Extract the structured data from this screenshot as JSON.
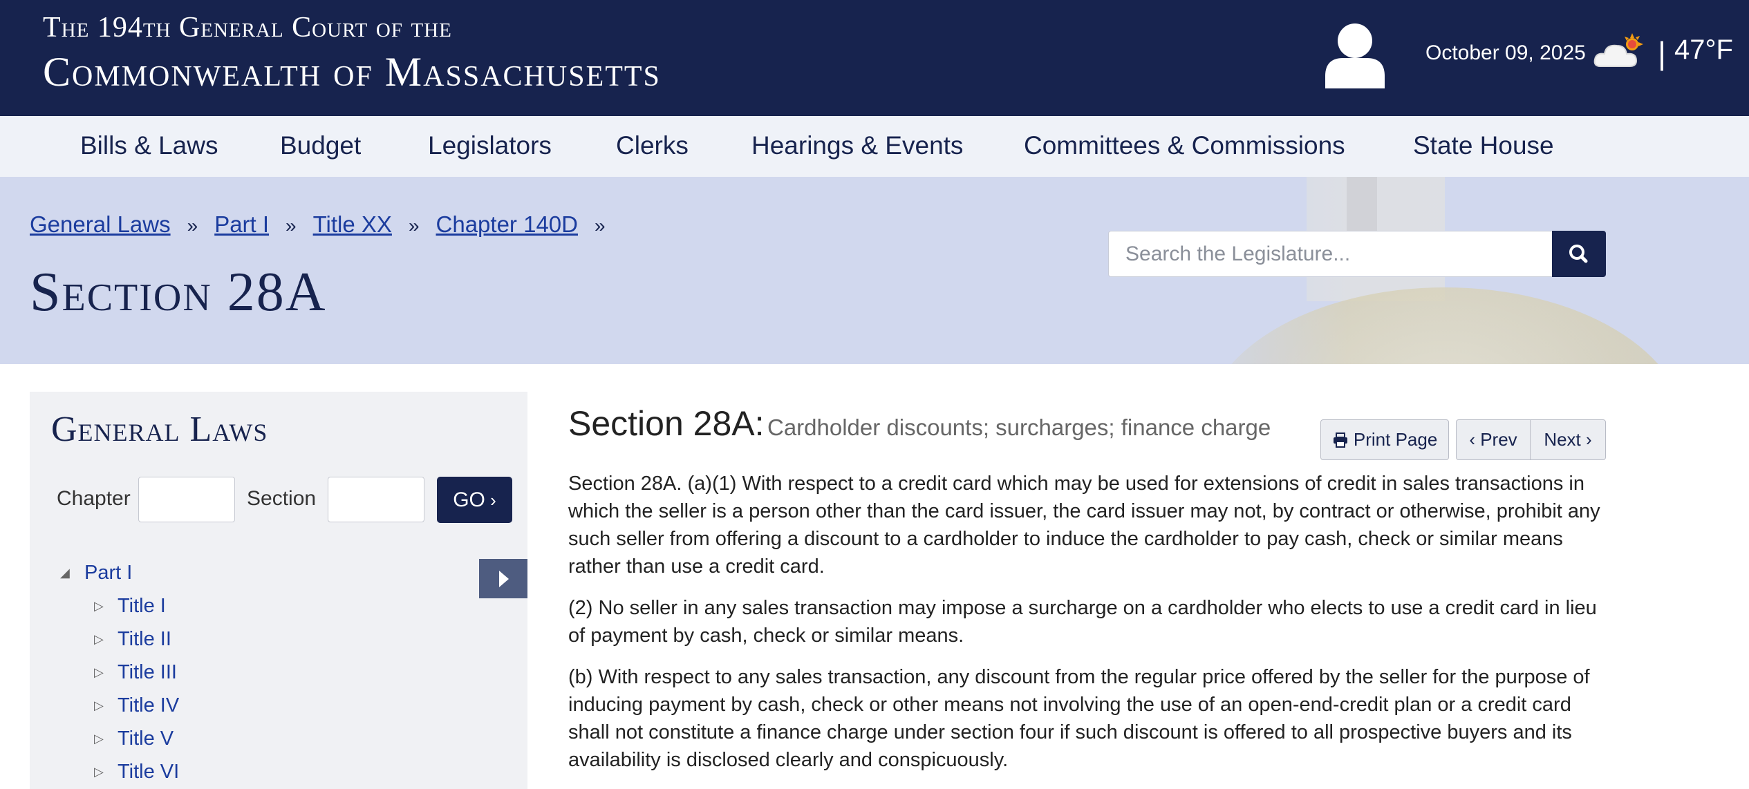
{
  "header": {
    "court_line": "The 194th General Court of the",
    "commonwealth": "Commonwealth of Massachusetts",
    "date": "October 09, 2025",
    "temp_sep": "|",
    "temperature": "47°F",
    "icons": {
      "user": "user-icon",
      "weather": "partly-cloudy-icon"
    }
  },
  "nav": {
    "items": [
      {
        "label": "Bills & Laws"
      },
      {
        "label": "Budget"
      },
      {
        "label": "Legislators"
      },
      {
        "label": "Clerks"
      },
      {
        "label": "Hearings & Events"
      },
      {
        "label": "Committees & Commissions"
      },
      {
        "label": "State House"
      }
    ]
  },
  "breadcrumb": {
    "items": [
      "General Laws",
      "Part I",
      "Title XX",
      "Chapter 140D"
    ],
    "separator": "»"
  },
  "page": {
    "title": "Section 28A"
  },
  "search": {
    "placeholder": "Search the Legislature...",
    "icon": "search-icon"
  },
  "sidebar": {
    "title": "General Laws",
    "chapter_label": "Chapter",
    "section_label": "Section",
    "go_label": "GO",
    "tree": {
      "part": "Part I",
      "titles": [
        "Title I",
        "Title II",
        "Title III",
        "Title IV",
        "Title V",
        "Title VI"
      ]
    }
  },
  "content": {
    "section_label": "Section 28A:",
    "caption": "Cardholder discounts; surcharges; finance charge",
    "buttons": {
      "print": "Print Page",
      "prev": "Prev",
      "next": "Next"
    },
    "paragraphs": [
      "Section 28A. (a)(1) With respect to a credit card which may be used for extensions of credit in sales transactions in which the seller is a person other than the card issuer, the card issuer may not, by contract or otherwise, prohibit any such seller from offering a discount to a cardholder to induce the cardholder to pay cash, check or similar means rather than use a credit card.",
      "(2) No seller in any sales transaction may impose a surcharge on a cardholder who elects to use a credit card in lieu of payment by cash, check or similar means.",
      "(b) With respect to any sales transaction, any discount from the regular price offered by the seller for the purpose of inducing payment by cash, check or other means not involving the use of an open-end-credit plan or a credit card shall not constitute a finance charge under section four if such discount is offered to all prospective buyers and its availability is disclosed clearly and conspicuously."
    ]
  },
  "colors": {
    "navy": "#17234e",
    "link": "#1b3c9e",
    "hero_bg": "#d1d8ee",
    "sidebar_bg": "#f0f1f4"
  }
}
